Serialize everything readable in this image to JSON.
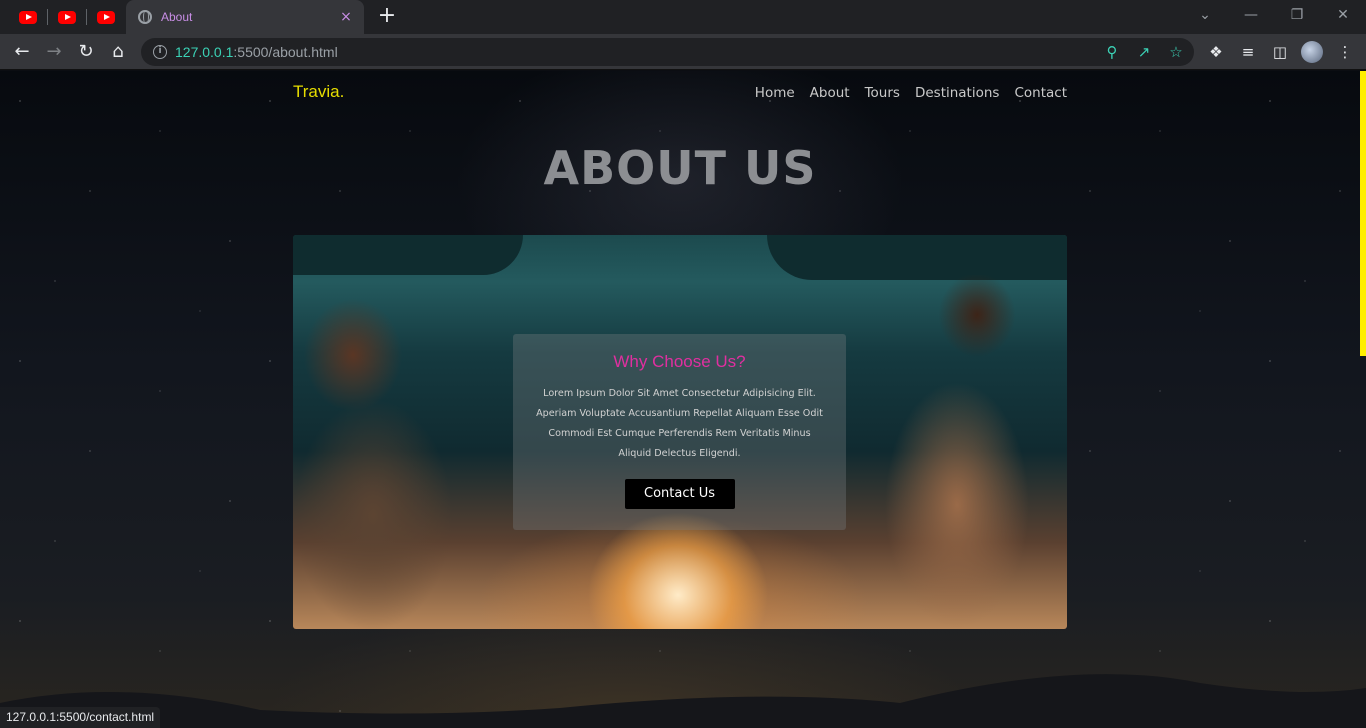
{
  "browser": {
    "pinned_tabs": [
      "youtube",
      "youtube",
      "youtube"
    ],
    "active_tab": {
      "title": "About",
      "close_glyph": "×"
    },
    "new_tab_glyph": "+",
    "window_controls": {
      "dropdown": "⌄",
      "minimize": "—",
      "restore": "❐",
      "close": "✕"
    },
    "url": {
      "host": "127.0.0.1",
      "rest": ":5500/about.html"
    },
    "status_url": "127.0.0.1:5500/contact.html"
  },
  "site": {
    "logo": "Travia.",
    "nav": [
      "Home",
      "About",
      "Tours",
      "Destinations",
      "Contact"
    ],
    "page_title": "ABOUT US",
    "card": {
      "title": "Why Choose Us?",
      "text": "Lorem Ipsum Dolor Sit Amet Consectetur Adipisicing Elit. Aperiam Voluptate Accusantium Repellat Aliquam Esse Odit Commodi Est Cumque Perferendis Rem Veritatis Minus Aliquid Delectus Eligendi.",
      "button": "Contact Us"
    }
  },
  "colors": {
    "logo": "#e6dd00",
    "card_title": "#e02fa0",
    "accent_url": "#3bd1b5",
    "scroll_thumb": "#ffee00"
  }
}
